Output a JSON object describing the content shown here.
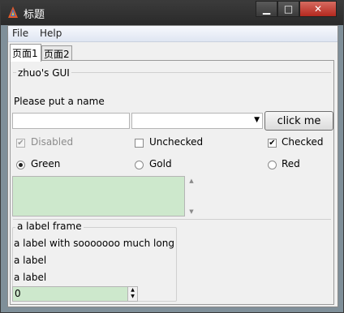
{
  "window": {
    "title": "标题"
  },
  "menu": {
    "file": "File",
    "help": "Help"
  },
  "tabs": [
    "页面1",
    "页面2"
  ],
  "page1": {
    "group_title": "zhuo's GUI",
    "prompt": "Please put a name",
    "name_input": {
      "value": "",
      "placeholder": ""
    },
    "combo": {
      "value": ""
    },
    "click_button": "click me",
    "checkboxes": [
      {
        "label": "Disabled",
        "checked": true,
        "disabled": true
      },
      {
        "label": "Unchecked",
        "checked": false,
        "disabled": false
      },
      {
        "label": "Checked",
        "checked": true,
        "disabled": false
      }
    ],
    "radios": [
      {
        "label": "Green",
        "selected": true
      },
      {
        "label": "Gold",
        "selected": false
      },
      {
        "label": "Red",
        "selected": false
      }
    ],
    "text_area": {
      "value": "",
      "background": "#cde8cc"
    },
    "label_frame": {
      "title": "a label frame",
      "labels": [
        "a label with sooooooo much long",
        "a label",
        "a label"
      ],
      "spinbox_value": "0"
    }
  }
}
